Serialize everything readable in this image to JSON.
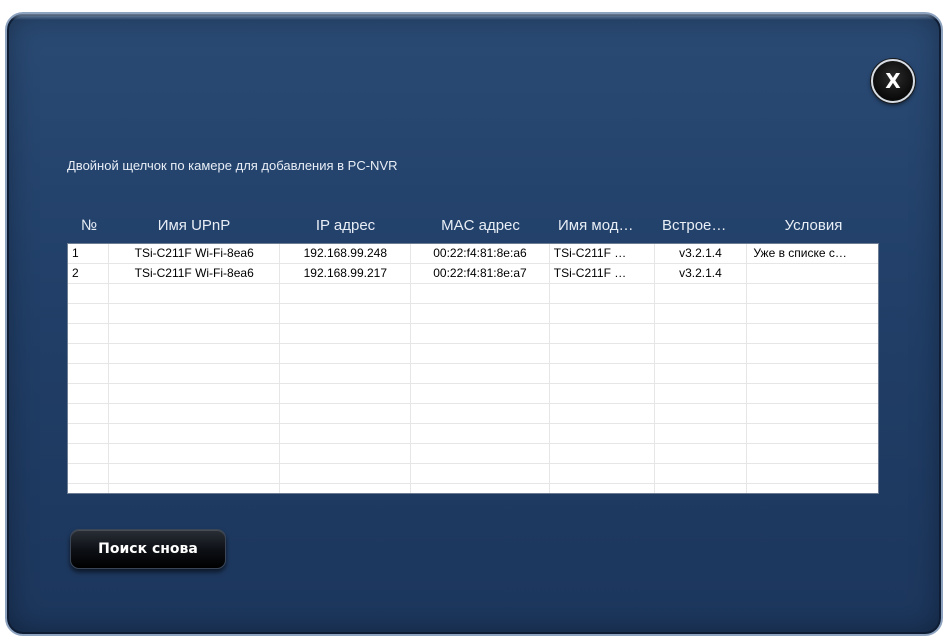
{
  "dialog": {
    "close_label": "X",
    "instruction": "Двойной щелчок по камере для добавления в PC-NVR",
    "search_again_label": "Поиск снова"
  },
  "table": {
    "columns": [
      "№",
      "Имя UPnP",
      "IP адрес",
      "MAC адрес",
      "Имя мод…",
      "Встрое…",
      "Условия"
    ],
    "rows": [
      [
        "1",
        "TSi-C211F Wi-Fi-8ea6",
        "192.168.99.248",
        "00:22:f4:81:8e:a6",
        "TSi-C211F …",
        "v3.2.1.4",
        "Уже в списке с…"
      ],
      [
        "2",
        "TSi-C211F Wi-Fi-8ea6",
        "192.168.99.217",
        "00:22:f4:81:8e:a7",
        "TSi-C211F …",
        "v3.2.1.4",
        ""
      ]
    ]
  },
  "colors": {
    "dialog_bg": "#213f68",
    "table_bg": "#ffffff",
    "header_text": "#e8eef6"
  },
  "icons": {
    "close": "close-icon"
  }
}
